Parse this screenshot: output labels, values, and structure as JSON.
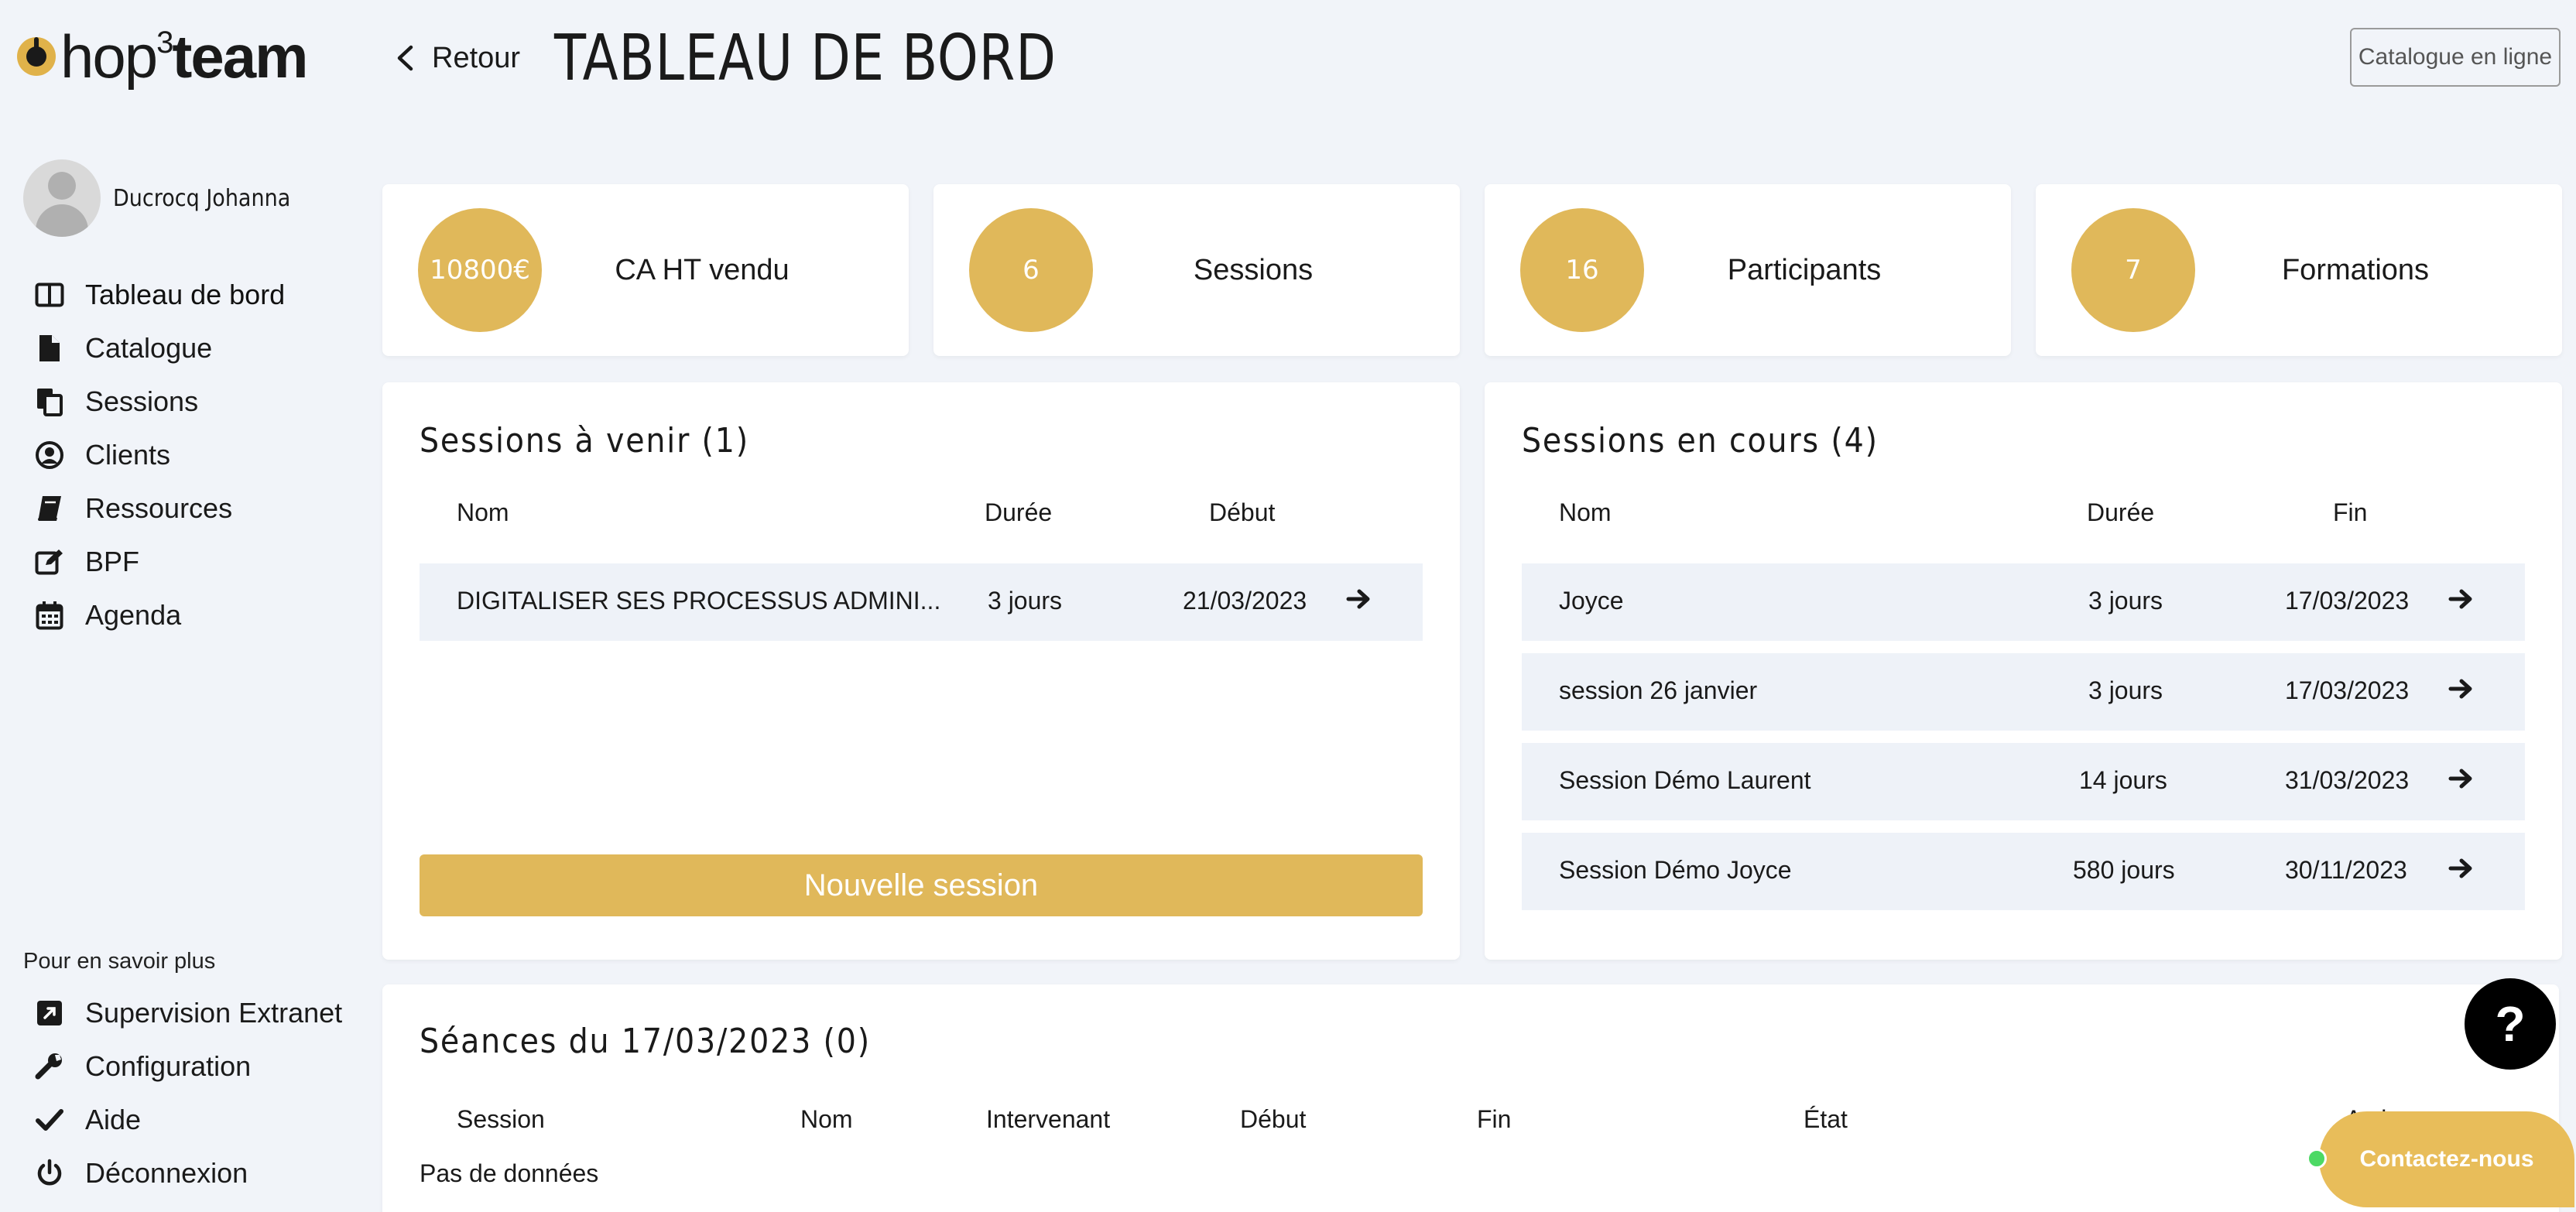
{
  "logo": {
    "pre": "hop",
    "sup": "3",
    "post": "team"
  },
  "header": {
    "back_label": "Retour",
    "title": "TABLEAU DE BORD",
    "catalogue_button": "Catalogue en ligne"
  },
  "user": {
    "name": "Ducrocq Johanna"
  },
  "sidebar": {
    "items": [
      {
        "label": "Tableau de bord",
        "icon": "columns-icon"
      },
      {
        "label": "Catalogue",
        "icon": "file-icon"
      },
      {
        "label": "Sessions",
        "icon": "copy-icon"
      },
      {
        "label": "Clients",
        "icon": "user-circle-icon"
      },
      {
        "label": "Ressources",
        "icon": "book-icon"
      },
      {
        "label": "BPF",
        "icon": "edit-icon"
      },
      {
        "label": "Agenda",
        "icon": "calendar-icon"
      }
    ],
    "more_title": "Pour en savoir plus",
    "more_items": [
      {
        "label": "Supervision Extranet",
        "icon": "external-link-icon"
      },
      {
        "label": "Configuration",
        "icon": "wrench-icon"
      },
      {
        "label": "Aide",
        "icon": "check-icon"
      },
      {
        "label": "Déconnexion",
        "icon": "power-icon"
      }
    ]
  },
  "stats": [
    {
      "value": "10800€",
      "label": "CA HT vendu"
    },
    {
      "value": "6",
      "label": "Sessions"
    },
    {
      "value": "16",
      "label": "Participants"
    },
    {
      "value": "7",
      "label": "Formations"
    }
  ],
  "upcoming": {
    "title": "Sessions à venir (1)",
    "headers": {
      "name": "Nom",
      "duration": "Durée",
      "date": "Début"
    },
    "rows": [
      {
        "name": "DIGITALISER SES PROCESSUS ADMINI...",
        "duration": "3 jours",
        "date": "21/03/2023"
      }
    ],
    "new_session_button": "Nouvelle session"
  },
  "ongoing": {
    "title": "Sessions en cours (4)",
    "headers": {
      "name": "Nom",
      "duration": "Durée",
      "date": "Fin"
    },
    "rows": [
      {
        "name": "Joyce",
        "duration": "3 jours",
        "date": "17/03/2023"
      },
      {
        "name": "session 26 janvier",
        "duration": "3 jours",
        "date": "17/03/2023"
      },
      {
        "name": "Session Démo Laurent",
        "duration": "14 jours",
        "date": "31/03/2023"
      },
      {
        "name": "Session Démo Joyce",
        "duration": "580 jours",
        "date": "30/11/2023"
      }
    ]
  },
  "seances": {
    "title": "Séances du 17/03/2023 (0)",
    "headers": [
      "Session",
      "Nom",
      "Intervenant",
      "Début",
      "Fin",
      "État",
      "Acti"
    ],
    "empty": "Pas de données"
  },
  "help_button": "?",
  "contact_button": "Contactez-nous",
  "colors": {
    "accent": "#e0b85a",
    "background": "#f1f4f9",
    "row": "#eef2f8"
  }
}
